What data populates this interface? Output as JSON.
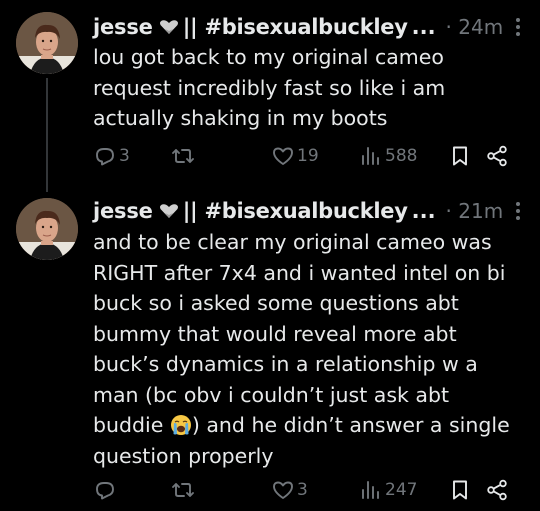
{
  "tweets": [
    {
      "display_name": "jesse",
      "handle": "|| #bisexualbuckley",
      "ellipsis": "...",
      "timestamp": "· 24m",
      "text": "lou got back to my original cameo\nrequest incredibly fast so like i am\nactually shaking in my boots",
      "replies": "3",
      "retweets": "",
      "likes": "19",
      "views": "588"
    },
    {
      "display_name": "jesse",
      "handle": "|| #bisexualbuckley",
      "ellipsis": "...",
      "timestamp": "· 21m",
      "text_before_emoji": "and to be clear my original cameo was\nRIGHT after 7x4 and i wanted intel on bi\nbuck so i asked some questions abt\nbummy that would reveal more abt\nbuck’s dynamics in a relationship w a\nman (bc obv i couldn’t just ask abt\nbuddie ",
      "emoji": "crying-face-emoji",
      "text_after_emoji": ") and he didn’t answer a single\nquestion properly",
      "replies": "",
      "retweets": "",
      "likes": "3",
      "views": "247"
    }
  ],
  "icons": {
    "reply": "reply-icon",
    "retweet": "retweet-icon",
    "like": "heart-icon",
    "views": "views-icon",
    "bookmark": "bookmark-icon",
    "share": "share-icon",
    "more": "more-icon",
    "badge": "white-heart-badge-icon"
  },
  "colors": {
    "background": "#000000",
    "text": "#e7e9ea",
    "muted": "#71767b",
    "thread_line": "#333639"
  }
}
